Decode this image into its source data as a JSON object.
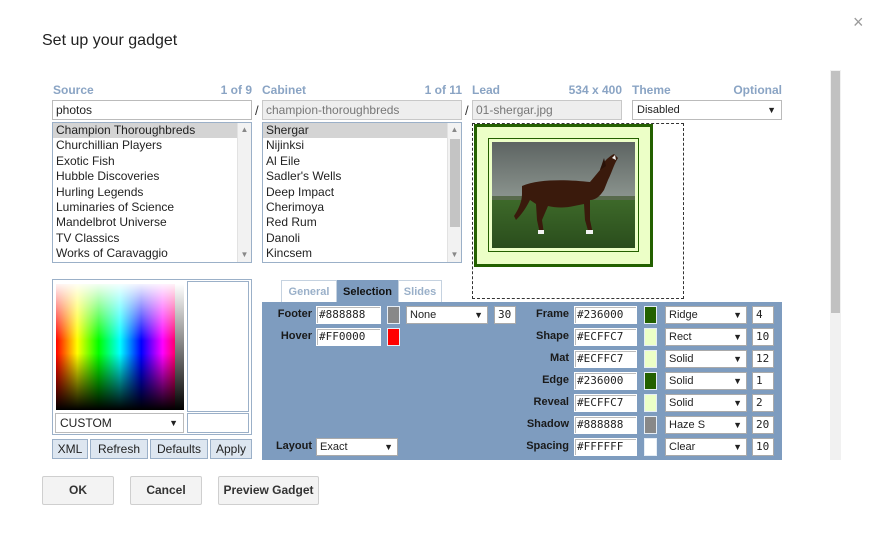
{
  "dialog": {
    "title": "Set up your gadget",
    "close_glyph": "×"
  },
  "source": {
    "label": "Source",
    "count": "1 of 9",
    "value": "photos",
    "items": [
      "Champion Thoroughbreds",
      "Churchillian Players",
      "Exotic Fish",
      "Hubble Discoveries",
      "Hurling Legends",
      "Luminaries of Science",
      "Mandelbrot Universe",
      "TV Classics",
      "Works of Caravaggio"
    ],
    "selected_index": 0
  },
  "cabinet": {
    "label": "Cabinet",
    "count": "1 of 11",
    "value": "champion-thoroughbreds",
    "items": [
      "Shergar",
      "Nijinksi",
      "Al Eile",
      "Sadler's Wells",
      "Deep Impact",
      "Cherimoya",
      "Red Rum",
      "Danoli",
      "Kincsem"
    ],
    "selected_index": 0
  },
  "lead": {
    "label": "Lead",
    "dims": "534 x 400",
    "value": "01-shergar.jpg"
  },
  "theme": {
    "label": "Theme",
    "optional": "Optional",
    "value": "Disabled"
  },
  "separator": "/",
  "colorpicker": {
    "mode": "CUSTOM",
    "buttons": {
      "xml": "XML",
      "refresh": "Refresh",
      "defaults": "Defaults",
      "apply": "Apply"
    }
  },
  "tabs": [
    {
      "label": "General"
    },
    {
      "label": "Selection"
    },
    {
      "label": "Slides"
    }
  ],
  "active_tab": "Selection",
  "selection": {
    "footer": {
      "label": "Footer",
      "color": "#888888",
      "style": "None",
      "size": "30"
    },
    "hover": {
      "label": "Hover",
      "color": "#FF0000"
    },
    "layout": {
      "label": "Layout",
      "value": "Exact"
    },
    "rows": [
      {
        "label": "Frame",
        "color": "#236000",
        "style": "Ridge",
        "size": "4"
      },
      {
        "label": "Shape",
        "color": "#ECFFC7",
        "style": "Rect",
        "size": "10"
      },
      {
        "label": "Mat",
        "color": "#ECFFC7",
        "style": "Solid",
        "size": "12"
      },
      {
        "label": "Edge",
        "color": "#236000",
        "style": "Solid",
        "size": "1"
      },
      {
        "label": "Reveal",
        "color": "#ECFFC7",
        "style": "Solid",
        "size": "2"
      },
      {
        "label": "Shadow",
        "color": "#888888",
        "style": "Haze S",
        "size": "20"
      },
      {
        "label": "Spacing",
        "color": "#FFFFFF",
        "style": "Clear",
        "size": "10"
      }
    ]
  },
  "footer_buttons": {
    "ok": "OK",
    "cancel": "Cancel",
    "preview": "Preview Gadget"
  },
  "accent_colors": {
    "header_label": "#8aa4c4",
    "panel": "#7e9cbf"
  }
}
